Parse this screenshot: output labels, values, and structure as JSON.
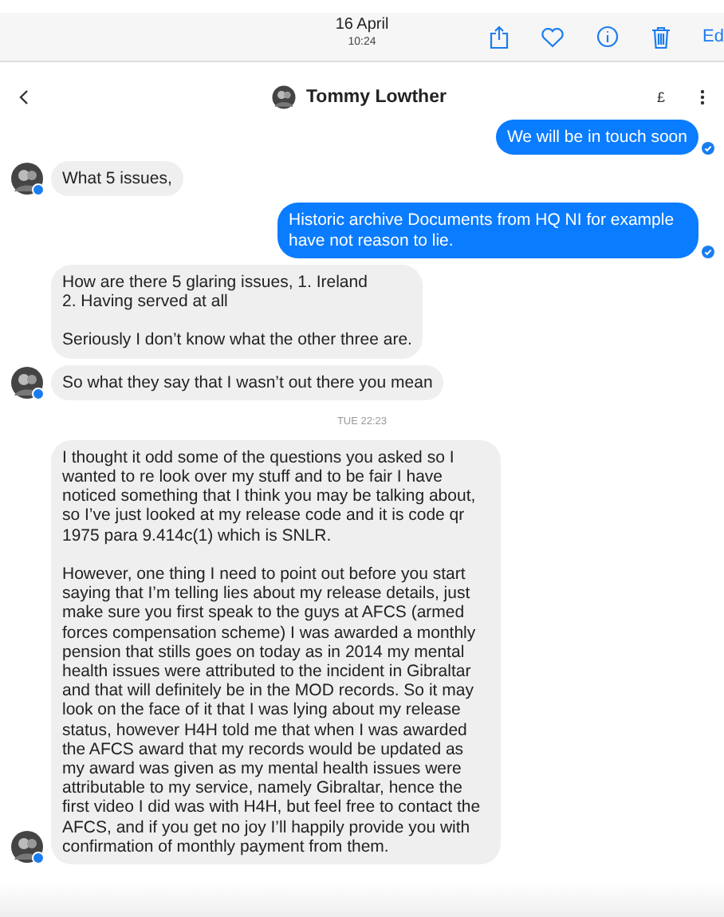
{
  "photo_bar": {
    "date": "16 April",
    "time": "10:24",
    "edit_label": "Ed"
  },
  "chat_header": {
    "name": "Tommy Lowther",
    "currency": "£"
  },
  "messages": [
    {
      "kind": "sent",
      "text": "We will be in touch soon"
    },
    {
      "kind": "received",
      "text": "What 5 issues,",
      "avatar": true
    },
    {
      "kind": "sent",
      "text": "Historic archive Documents from HQ NI for example have not reason to lie."
    },
    {
      "kind": "received",
      "text": "How are there 5 glaring issues, 1. Ireland\n2. Having served at all\n\nSeriously I don’t know what the other three are.",
      "avatar": false
    },
    {
      "kind": "received",
      "text": "So what they say that I wasn’t out there you mean",
      "avatar": true
    },
    {
      "kind": "timestamp",
      "text": "TUE 22:23"
    },
    {
      "kind": "received",
      "text": "I thought it odd some of the questions you asked so I wanted to re look over my stuff and to be fair I have noticed something that I think you may be talking about, so I’ve just looked at my release code and it is code qr 1975 para 9.414c(1) which is SNLR.\n\nHowever, one thing I need to point out before you start saying that I’m telling lies about my release details, just make sure you first speak to the guys at AFCS (armed forces compensation scheme) I was awarded a monthly pension that stills goes on today as in 2014 my mental health issues were attributed to the incident in Gibraltar and that will definitely be in the MOD records. So it may look on the face of it that I was lying about my release status, however H4H told me that when I was awarded the AFCS award that my records would be updated as my award was given as my mental health issues were attributable to my service, namely Gibraltar, hence the first video I did was with H4H, but feel free to contact the AFCS, and if you get no joy I’ll happily provide you with confirmation of monthly payment from them.",
      "avatar": true
    }
  ]
}
